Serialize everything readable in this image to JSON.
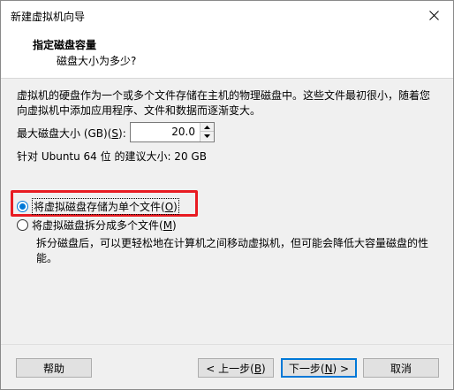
{
  "window": {
    "title": "新建虚拟机向导",
    "close_icon": "close-icon"
  },
  "header": {
    "title": "指定磁盘容量",
    "subtitle": "磁盘大小为多少?"
  },
  "description": "虚拟机的硬盘作为一个或多个文件存储在主机的物理磁盘中。这些文件最初很小，随着您向虚拟机中添加应用程序、文件和数据而逐渐变大。",
  "max_size": {
    "label_prefix": "最大磁盘大小 (GB)(",
    "label_key": "S",
    "label_suffix": "):",
    "value": "20.0"
  },
  "recommendation": "针对 Ubuntu 64 位 的建议大小: 20 GB",
  "options": {
    "single_file": {
      "label_prefix": "将虚拟磁盘存储为单个文件(",
      "label_key": "O",
      "label_suffix": ")",
      "checked": true
    },
    "multiple_files": {
      "label_prefix": "将虚拟磁盘拆分成多个文件(",
      "label_key": "M",
      "label_suffix": ")",
      "checked": false,
      "description": "拆分磁盘后，可以更轻松地在计算机之间移动虚拟机，但可能会降低大容量磁盘的性能。"
    }
  },
  "buttons": {
    "help": "帮助",
    "back_prefix": "< 上一步(",
    "back_key": "B",
    "back_suffix": ")",
    "next_prefix": "下一步(",
    "next_key": "N",
    "next_suffix": ") >",
    "cancel": "取消"
  },
  "colors": {
    "accent": "#0078d7",
    "highlight_box": "#e81b22"
  }
}
